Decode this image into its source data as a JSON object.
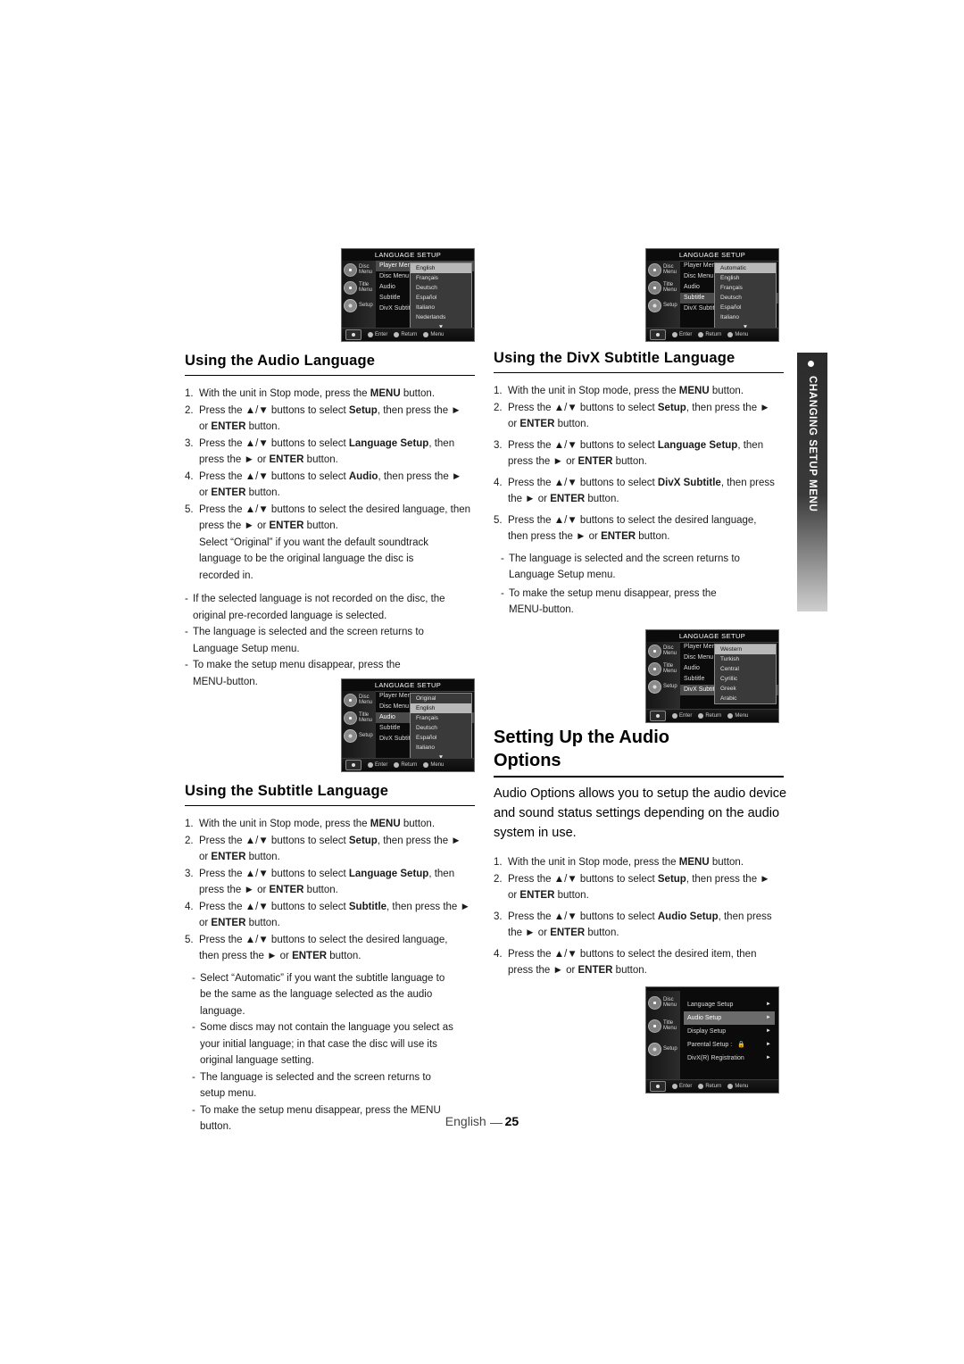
{
  "page": {
    "footer_lang": "English",
    "footer_page": "25"
  },
  "side_tab": {
    "label": "CHANGING SETUP MENU"
  },
  "sections": {
    "audio_language": {
      "heading": "Using the Audio Language",
      "steps": [
        {
          "num": "1.",
          "parts": [
            {
              "t": "With the unit in Stop mode, press the "
            },
            {
              "t": "MENU",
              "b": true
            },
            {
              "t": " button."
            }
          ]
        },
        {
          "num": "2.",
          "parts": [
            {
              "t": "Press the ▲/▼ buttons to select "
            },
            {
              "t": "Setup",
              "b": true
            },
            {
              "t": ", then press the ►"
            }
          ]
        },
        {
          "num": "",
          "cont": true,
          "parts": [
            {
              "t": "or "
            },
            {
              "t": "ENTER",
              "b": true
            },
            {
              "t": " button."
            }
          ]
        },
        {
          "num": "3.",
          "parts": [
            {
              "t": "Press the ▲/▼ buttons to select "
            },
            {
              "t": "Language Setup",
              "b": true
            },
            {
              "t": ", then"
            }
          ]
        },
        {
          "num": "",
          "cont": true,
          "parts": [
            {
              "t": "press the ► or "
            },
            {
              "t": "ENTER",
              "b": true
            },
            {
              "t": " button."
            }
          ]
        },
        {
          "num": "4.",
          "parts": [
            {
              "t": "Press the ▲/▼ buttons to select "
            },
            {
              "t": "Audio",
              "b": true
            },
            {
              "t": ", then press the ►"
            }
          ]
        },
        {
          "num": "",
          "cont": true,
          "parts": [
            {
              "t": "or "
            },
            {
              "t": "ENTER",
              "b": true
            },
            {
              "t": " button."
            }
          ]
        },
        {
          "num": "5.",
          "parts": [
            {
              "t": "Press the ▲/▼ buttons to select the desired language, then"
            }
          ]
        },
        {
          "num": "",
          "cont": true,
          "parts": [
            {
              "t": "press the ► or "
            },
            {
              "t": "ENTER",
              "b": true
            },
            {
              "t": " button."
            }
          ]
        },
        {
          "num": "",
          "cont": true,
          "parts": [
            {
              "t": "Select “Original” if you want the default soundtrack"
            }
          ]
        },
        {
          "num": "",
          "cont": true,
          "parts": [
            {
              "t": "language to be the original language the disc is"
            }
          ]
        },
        {
          "num": "",
          "cont": true,
          "parts": [
            {
              "t": "recorded in."
            }
          ]
        }
      ],
      "notes": [
        {
          "dash": "-",
          "lines": [
            "If the selected language is not recorded on the disc, the",
            "original pre-recorded language is selected."
          ]
        },
        {
          "dash": "-",
          "lines": [
            "The language is selected and the screen returns to",
            "Language Setup menu."
          ]
        },
        {
          "dash": "-",
          "lines": [
            "To make the setup menu disappear, press the",
            "MENU-button."
          ]
        }
      ]
    },
    "subtitle_language": {
      "heading": "Using the Subtitle Language",
      "steps": [
        {
          "num": "1.",
          "parts": [
            {
              "t": "With the unit in Stop mode, press the "
            },
            {
              "t": "MENU",
              "b": true
            },
            {
              "t": " button."
            }
          ]
        },
        {
          "num": "2.",
          "parts": [
            {
              "t": "Press the ▲/▼ buttons to select "
            },
            {
              "t": "Setup",
              "b": true
            },
            {
              "t": ", then press the ►"
            }
          ]
        },
        {
          "num": "",
          "cont": true,
          "parts": [
            {
              "t": "or "
            },
            {
              "t": "ENTER",
              "b": true
            },
            {
              "t": " button."
            }
          ]
        },
        {
          "num": "3.",
          "parts": [
            {
              "t": "Press the ▲/▼ buttons to select "
            },
            {
              "t": "Language Setup",
              "b": true
            },
            {
              "t": ", then"
            }
          ]
        },
        {
          "num": "",
          "cont": true,
          "parts": [
            {
              "t": "press the ► or "
            },
            {
              "t": "ENTER",
              "b": true
            },
            {
              "t": " button."
            }
          ]
        },
        {
          "num": "4.",
          "parts": [
            {
              "t": "Press the ▲/▼ buttons to select "
            },
            {
              "t": "Subtitle",
              "b": true
            },
            {
              "t": ", then press the ►"
            }
          ]
        },
        {
          "num": "",
          "cont": true,
          "parts": [
            {
              "t": "or "
            },
            {
              "t": "ENTER",
              "b": true
            },
            {
              "t": " button."
            }
          ]
        },
        {
          "num": "5.",
          "parts": [
            {
              "t": "Press the ▲/▼ buttons to select the desired language,"
            }
          ]
        },
        {
          "num": "",
          "cont": true,
          "parts": [
            {
              "t": "then press the ► or "
            },
            {
              "t": "ENTER",
              "b": true
            },
            {
              "t": " button."
            }
          ]
        }
      ],
      "notes": [
        {
          "dash": "-",
          "lines": [
            "Select “Automatic” if you want the subtitle language to",
            "be the same as the language selected as the audio",
            "language."
          ]
        },
        {
          "dash": "-",
          "lines": [
            "Some discs may not contain the language you select as",
            "your initial language; in that case the disc will use its",
            "original language setting."
          ]
        },
        {
          "dash": "-",
          "lines": [
            "The language is selected and the screen returns to",
            "setup menu."
          ]
        },
        {
          "dash": "-",
          "lines": [
            "To make the setup menu disappear, press the MENU",
            "button."
          ]
        }
      ]
    },
    "divx_subtitle": {
      "heading": "Using the DivX Subtitle Language",
      "steps": [
        {
          "num": "1.",
          "parts": [
            {
              "t": "With the unit in Stop mode, press the "
            },
            {
              "t": "MENU",
              "b": true
            },
            {
              "t": " button."
            }
          ]
        },
        {
          "num": "2.",
          "parts": [
            {
              "t": "Press the ▲/▼ buttons to select "
            },
            {
              "t": "Setup",
              "b": true
            },
            {
              "t": ", then press the ►"
            }
          ]
        },
        {
          "num": "",
          "cont": true,
          "parts": [
            {
              "t": "or "
            },
            {
              "t": "ENTER",
              "b": true
            },
            {
              "t": " button."
            }
          ]
        },
        {
          "num": "3.",
          "parts": [
            {
              "t": "Press the ▲/▼ buttons to select "
            },
            {
              "t": "Language Setup",
              "b": true
            },
            {
              "t": ", then"
            }
          ]
        },
        {
          "num": "",
          "cont": true,
          "parts": [
            {
              "t": "press the ► or "
            },
            {
              "t": "ENTER",
              "b": true
            },
            {
              "t": " button."
            }
          ]
        },
        {
          "num": "4.",
          "parts": [
            {
              "t": "Press the ▲/▼ buttons to select "
            },
            {
              "t": "DivX Subtitle",
              "b": true
            },
            {
              "t": ", then press"
            }
          ]
        },
        {
          "num": "",
          "cont": true,
          "parts": [
            {
              "t": "the ► or "
            },
            {
              "t": "ENTER",
              "b": true
            },
            {
              "t": " button."
            }
          ]
        },
        {
          "num": "5.",
          "parts": [
            {
              "t": "Press the ▲/▼ buttons to select the desired language,"
            }
          ]
        },
        {
          "num": "",
          "cont": true,
          "parts": [
            {
              "t": "then press the ► or "
            },
            {
              "t": "ENTER",
              "b": true
            },
            {
              "t": " button."
            }
          ]
        }
      ],
      "notes": [
        {
          "dash": "-",
          "lines": [
            "The language is selected and the screen returns to",
            "Language Setup menu."
          ]
        },
        {
          "dash": "-",
          "lines": [
            "To make the setup menu disappear, press the",
            "MENU-button."
          ]
        }
      ]
    },
    "audio_options": {
      "heading_line1": "Setting Up the Audio",
      "heading_line2": "Options",
      "intro": "Audio Options allows you to setup the audio device and sound status settings depending on the audio system in use.",
      "steps": [
        {
          "num": "1.",
          "parts": [
            {
              "t": "With the unit in Stop mode, press the "
            },
            {
              "t": "MENU",
              "b": true
            },
            {
              "t": " button."
            }
          ]
        },
        {
          "num": "2.",
          "parts": [
            {
              "t": "Press the ▲/▼ buttons to select "
            },
            {
              "t": "Setup",
              "b": true
            },
            {
              "t": ", then press the ►"
            }
          ]
        },
        {
          "num": "",
          "cont": true,
          "parts": [
            {
              "t": "or "
            },
            {
              "t": "ENTER",
              "b": true
            },
            {
              "t": " button."
            }
          ]
        },
        {
          "num": "3.",
          "parts": [
            {
              "t": "Press the ▲/▼ buttons to select "
            },
            {
              "t": "Audio Setup",
              "b": true
            },
            {
              "t": ", then press"
            }
          ]
        },
        {
          "num": "",
          "cont": true,
          "parts": [
            {
              "t": "the ► or "
            },
            {
              "t": "ENTER",
              "b": true
            },
            {
              "t": " button."
            }
          ]
        },
        {
          "num": "4.",
          "parts": [
            {
              "t": "Press the ▲/▼ buttons to select the desired item, then"
            }
          ]
        },
        {
          "num": "",
          "cont": true,
          "parts": [
            {
              "t": "press the ► or "
            },
            {
              "t": "ENTER",
              "b": true
            },
            {
              "t": " button."
            }
          ]
        }
      ]
    }
  },
  "osd_common": {
    "title": "LANGUAGE SETUP",
    "icon_labels": [
      "Disc Menu",
      "Title Menu",
      "Setup"
    ],
    "footer": [
      {
        "glyph": "dot",
        "label": "Enter"
      },
      {
        "glyph": "dot",
        "label": "Return"
      },
      {
        "glyph": "dot",
        "label": "Menu"
      }
    ]
  },
  "osd_screens": [
    {
      "id": "player-menu-language",
      "title": "LANGUAGE SETUP",
      "menu": [
        {
          "label": "Player Menu",
          "state": "highlight"
        },
        {
          "label": "Disc Menu",
          "state": "normal"
        },
        {
          "label": "Audio",
          "state": "normal"
        },
        {
          "label": "Subtitle",
          "state": "normal"
        },
        {
          "label": "DivX Subtitle",
          "state": "normal"
        }
      ],
      "list": [
        "English",
        "Français",
        "Deutsch",
        "Español",
        "Italiano",
        "Nederlands"
      ],
      "selected": "English",
      "has_scroll_down": true
    },
    {
      "id": "subtitle-language",
      "title": "LANGUAGE SETUP",
      "menu": [
        {
          "label": "Player Menu",
          "state": "normal"
        },
        {
          "label": "Disc Menu",
          "state": "normal"
        },
        {
          "label": "Audio",
          "state": "normal"
        },
        {
          "label": "Subtitle",
          "state": "highlight"
        },
        {
          "label": "DivX Subtitle",
          "state": "normal"
        }
      ],
      "list": [
        "Automatic",
        "English",
        "Français",
        "Deutsch",
        "Español",
        "Italiano"
      ],
      "selected": "Automatic",
      "has_scroll_down": true
    },
    {
      "id": "audio-language",
      "title": "LANGUAGE SETUP",
      "menu": [
        {
          "label": "Player Menu",
          "state": "normal"
        },
        {
          "label": "Disc Menu",
          "state": "normal"
        },
        {
          "label": "Audio",
          "state": "highlight"
        },
        {
          "label": "Subtitle",
          "state": "normal"
        },
        {
          "label": "DivX Subtitle",
          "state": "normal"
        }
      ],
      "list": [
        "Original",
        "English",
        "Français",
        "Deutsch",
        "Español",
        "Italiano"
      ],
      "selected": "English",
      "has_scroll_down": true
    },
    {
      "id": "divx-subtitle-language",
      "title": "LANGUAGE SETUP",
      "menu": [
        {
          "label": "Player Menu",
          "state": "normal"
        },
        {
          "label": "Disc Menu",
          "state": "normal"
        },
        {
          "label": "Audio",
          "state": "normal"
        },
        {
          "label": "Subtitle",
          "state": "normal"
        },
        {
          "label": "DivX Subtitle",
          "state": "highlight"
        }
      ],
      "list": [
        "Western",
        "Turkish",
        "Central",
        "Cyrillic",
        "Greek",
        "Arabic"
      ],
      "selected": "Western",
      "has_scroll_down": false
    }
  ],
  "osd_setup_screen": {
    "id": "setup-menu",
    "title": "",
    "rows": [
      {
        "label": "Language Setup",
        "state": "normal",
        "arrow": "►"
      },
      {
        "label": "Audio Setup",
        "state": "highlight",
        "arrow": "►"
      },
      {
        "label": "Display Setup",
        "state": "normal",
        "arrow": "►"
      },
      {
        "label": "Parental Setup :",
        "state": "normal",
        "arrow": "►",
        "lock": true
      },
      {
        "label": "DivX(R) Registration",
        "state": "normal",
        "arrow": "►"
      }
    ]
  }
}
